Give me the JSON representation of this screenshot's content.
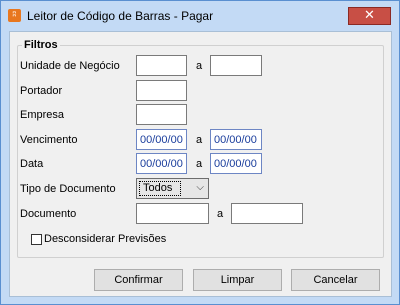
{
  "window": {
    "title": "Leitor de Código de Barras - Pagar",
    "close_glyph": "✕",
    "app_icon": "app-icon"
  },
  "filters": {
    "group_title": "Filtros",
    "unidade_label": "Unidade de Negócio",
    "unidade_from": "",
    "unidade_sep": "a",
    "unidade_to": "",
    "portador_label": "Portador",
    "portador_value": "",
    "empresa_label": "Empresa",
    "empresa_value": "",
    "vencimento_label": "Vencimento",
    "vencimento_from": "00/00/00",
    "vencimento_sep": "a",
    "vencimento_to": "00/00/00",
    "data_label": "Data",
    "data_from": "00/00/00",
    "data_sep": "a",
    "data_to": "00/00/00",
    "tipo_label": "Tipo de Documento",
    "tipo_value": "Todos",
    "documento_label": "Documento",
    "documento_from": "",
    "documento_sep": "a",
    "documento_to": "",
    "desconsiderar_label": "Desconsiderar Previsões",
    "desconsiderar_checked": false
  },
  "buttons": {
    "confirmar": "Confirmar",
    "limpar": "Limpar",
    "cancelar": "Cancelar"
  }
}
